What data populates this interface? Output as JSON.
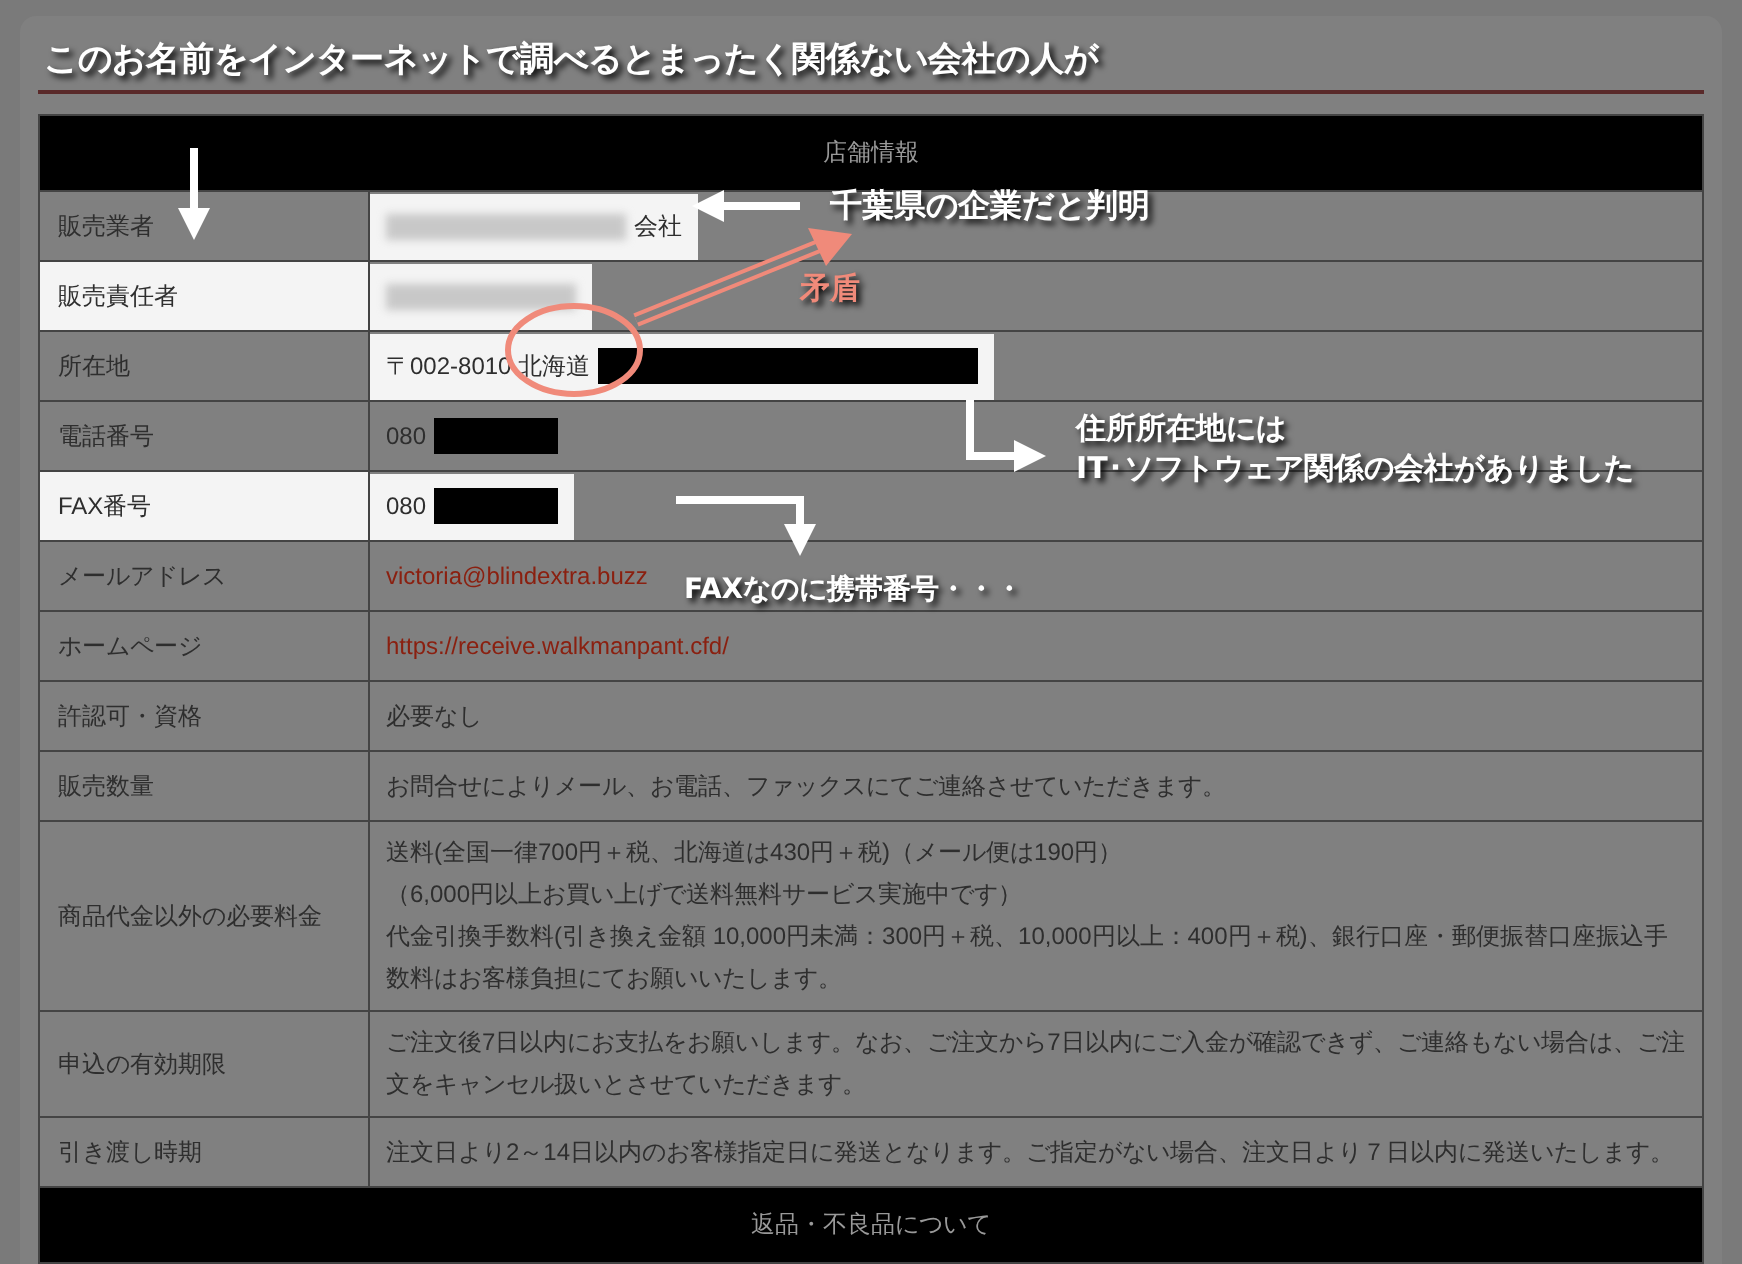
{
  "heading": "このお名前をインターネットで調べるとまったく関係ない会社の人が",
  "table": {
    "header": "店舗情報",
    "rows": [
      {
        "label": "販売業者",
        "label_highlighted": false,
        "value_highlighted": true,
        "parts": [
          {
            "kind": "blur"
          },
          {
            "kind": "text",
            "text": "会社"
          }
        ]
      },
      {
        "label": "販売責任者",
        "label_highlighted": true,
        "value_highlighted": true,
        "parts": [
          {
            "kind": "blur"
          }
        ]
      },
      {
        "label": "所在地",
        "label_highlighted": false,
        "value_highlighted": true,
        "parts": [
          {
            "kind": "text",
            "text": "〒002-8010 北海道"
          },
          {
            "kind": "redacted"
          }
        ]
      },
      {
        "label": "電話番号",
        "label_highlighted": false,
        "value_highlighted": false,
        "parts": [
          {
            "kind": "text",
            "text": "080"
          },
          {
            "kind": "redacted"
          }
        ]
      },
      {
        "label": "FAX番号",
        "label_highlighted": true,
        "value_highlighted": true,
        "parts": [
          {
            "kind": "text",
            "text": "080"
          },
          {
            "kind": "redacted"
          }
        ]
      },
      {
        "label": "メールアドレス",
        "label_highlighted": false,
        "value_highlighted": false,
        "parts": [
          {
            "kind": "link",
            "text": "victoria@blindextra.buzz"
          }
        ]
      },
      {
        "label": "ホームページ",
        "label_highlighted": false,
        "value_highlighted": false,
        "parts": [
          {
            "kind": "link",
            "text": "https://receive.walkmanpant.cfd/"
          }
        ]
      },
      {
        "label": "許認可・資格",
        "label_highlighted": false,
        "value_highlighted": false,
        "parts": [
          {
            "kind": "text",
            "text": "必要なし"
          }
        ]
      },
      {
        "label": "販売数量",
        "label_highlighted": false,
        "value_highlighted": false,
        "parts": [
          {
            "kind": "text",
            "text": "お問合せによりメール、お電話、ファックスにてご連絡させていただきます。"
          }
        ]
      },
      {
        "label": "商品代金以外の必要料金",
        "label_highlighted": false,
        "value_highlighted": false,
        "parts": [
          {
            "kind": "text",
            "text": "送料(全国一律700円＋税、北海道は430円＋税)（メール便は190円）"
          },
          {
            "kind": "text",
            "text": "（6,000円以上お買い上げで送料無料サービス実施中です）"
          },
          {
            "kind": "text",
            "text": "代金引換手数料(引き換え金額 10,000円未満：300円＋税、10,000円以上：400円＋税)、銀行口座・郵便振替口座振込手数料はお客様負担にてお願いいたします。"
          }
        ]
      },
      {
        "label": "申込の有効期限",
        "label_highlighted": false,
        "value_highlighted": false,
        "parts": [
          {
            "kind": "text",
            "text": "ご注文後7日以内にお支払をお願いします。なお、ご注文から7日以内にご入金が確認できず、ご連絡もない場合は、ご注文をキャンセル扱いとさせていただきます。"
          }
        ]
      },
      {
        "label": "引き渡し時期",
        "label_highlighted": false,
        "value_highlighted": false,
        "parts": [
          {
            "kind": "text",
            "text": "注文日より2～14日以内のお客様指定日に発送となります。ご指定がない場合、注文日より７日以内に発送いたします。"
          }
        ]
      }
    ],
    "footer_header": "返品・不良品について"
  },
  "annotations": [
    {
      "kind": "note",
      "text": "千葉県の企業だと判明"
    },
    {
      "kind": "warning",
      "text": "矛盾"
    },
    {
      "kind": "note",
      "text": "住所所在地には\nIT･ソフトウェア関係の会社がありました"
    },
    {
      "kind": "note",
      "text": "FAXなのに携帯番号・・・"
    }
  ]
}
